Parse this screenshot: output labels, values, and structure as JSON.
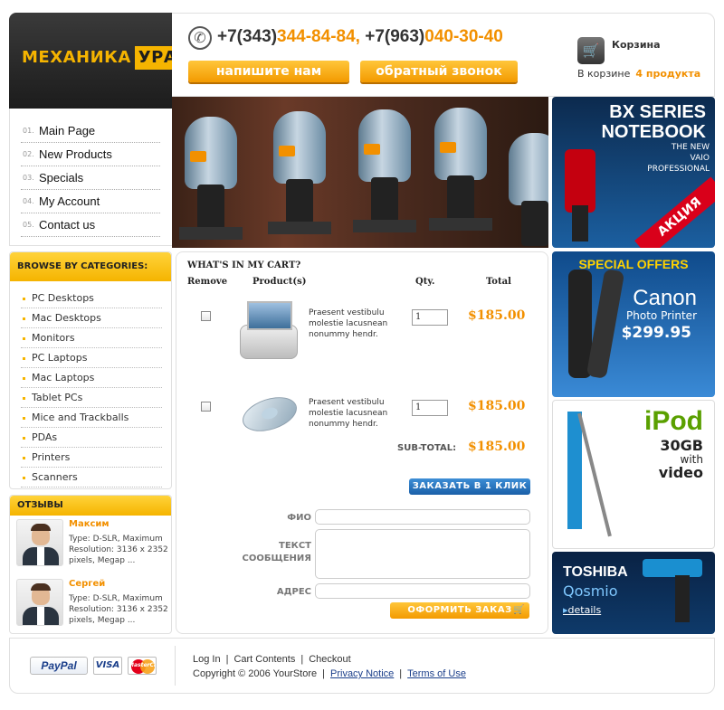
{
  "brand": {
    "part1": "МЕХАНИКА",
    "part2": "УРАЛА"
  },
  "header": {
    "phone1_code": "+7(343)",
    "phone1_num": "344-84-84,",
    "phone2_code": "+7(963)",
    "phone2_num": "040-30-40",
    "write_button": "напишите нам",
    "callback_button": "обратный звонок",
    "cart_title": "Корзина",
    "cart_line": "В корзине",
    "cart_count": "4 продукта"
  },
  "nav": {
    "items": [
      {
        "no": "01.",
        "label": "Main Page"
      },
      {
        "no": "02.",
        "label": "New Products"
      },
      {
        "no": "03.",
        "label": "Specials"
      },
      {
        "no": "04.",
        "label": "My Account"
      },
      {
        "no": "05.",
        "label": "Contact us"
      }
    ]
  },
  "banners": {
    "bx_title1": "BX SERIES",
    "bx_title2": "NOTEBOOK",
    "bx_sub1": "THE NEW",
    "bx_sub2": "VAIO",
    "bx_sub3": "PROFESSIONAL",
    "akcia": "АКЦИЯ",
    "special": "SPECIAL OFFERS",
    "canon": "Canon",
    "canon_sub": "Photo Printer",
    "canon_price": "$299.95",
    "ipod": "iPod",
    "ipod_gb": "30GB",
    "ipod_with": "with",
    "ipod_video": "video",
    "toshiba": "TOSHIBA",
    "qosmio": "Qosmio",
    "details": "details"
  },
  "categories": {
    "title": "BROWSE BY CATEGORIES:",
    "items": [
      "PC Desktops",
      "Mac Desktops",
      "Monitors",
      "PC Laptops",
      "Mac Laptops",
      "Tablet PCs",
      "Mice and Trackballs",
      "PDAs",
      "Printers",
      "Scanners"
    ]
  },
  "reviews": {
    "title": "ОТЗЫВЫ",
    "items": [
      {
        "name": "Максим",
        "text": "Type: D-SLR, Maximum Resolution: 3136 x 2352 pixels, Megap ..."
      },
      {
        "name": "Сергей",
        "text": "Type: D-SLR, Maximum Resolution: 3136 x 2352 pixels, Megap ..."
      }
    ]
  },
  "cart": {
    "heading": "WHAT'S IN MY CART?",
    "col_remove": "Remove",
    "col_product": "Product(s)",
    "col_qty": "Qty.",
    "col_total": "Total",
    "rows": [
      {
        "desc": "Praesent vestibulu molestie lacusnean nonummy hendr.",
        "qty": "1",
        "price": "$185.00"
      },
      {
        "desc": "Praesent vestibulu molestie lacusnean nonummy hendr.",
        "qty": "1",
        "price": "$185.00"
      }
    ],
    "subtotal_label": "SUB-TOTAL:",
    "subtotal_value": "$185.00",
    "one_click_button": "ЗАКАЗАТЬ В 1 КЛИК",
    "form": {
      "name_label": "ФИО",
      "message_label": "ТЕКСТ СООБЩЕНИЯ",
      "address_label": "АДРЕС",
      "submit_button": "ОФОРМИТЬ ЗАКАЗ"
    }
  },
  "footer": {
    "paypal": "PayPal",
    "visa": "VISA",
    "mastercard": "MasterCard",
    "link_login": "Log In",
    "link_cart": "Cart Contents",
    "link_checkout": "Checkout",
    "copyright": "Copyright © 2006 YourStore",
    "link_privacy": "Privacy Notice",
    "link_terms": "Terms of Use"
  },
  "colors": {
    "accent": "#f29000",
    "brand_yellow": "#f5b400",
    "link_blue": "#1a3e8a"
  },
  "icons": {
    "phone": "phone-icon",
    "cart": "cart-icon"
  }
}
